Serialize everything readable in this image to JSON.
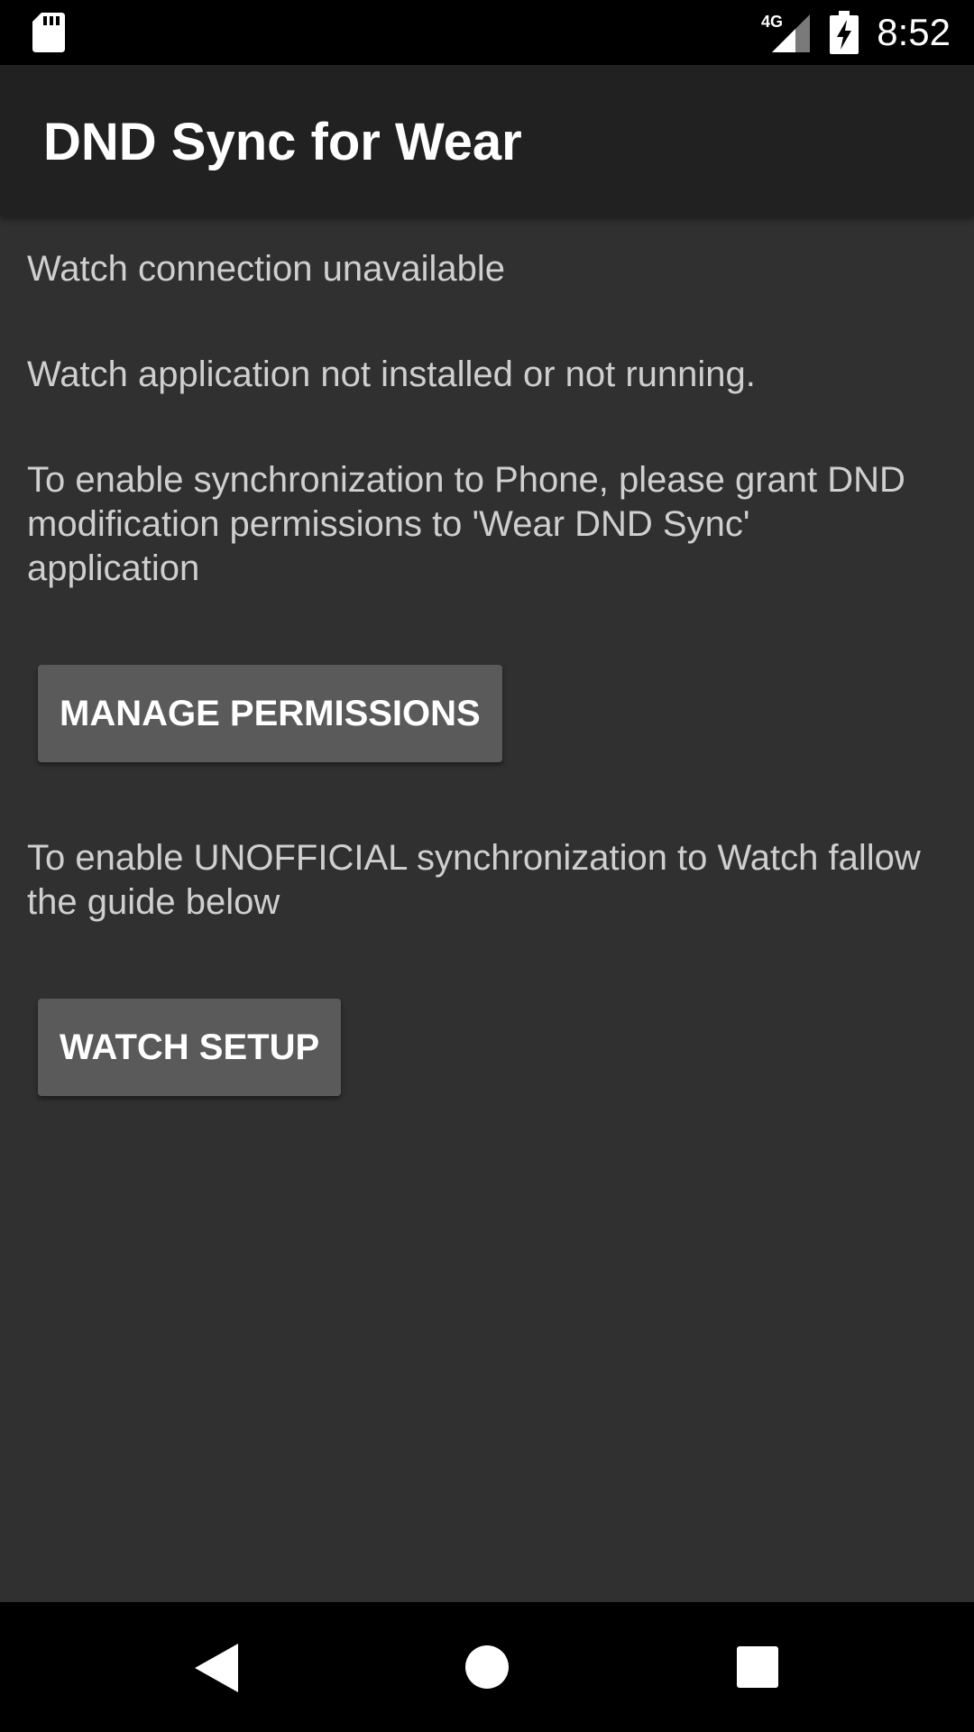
{
  "status_bar": {
    "time": "8:52",
    "network_label": "4G",
    "icons": [
      "sd-card-icon",
      "cell-signal-icon",
      "battery-charging-icon"
    ]
  },
  "toolbar": {
    "title": "DND Sync for Wear"
  },
  "content": {
    "connection_status": "Watch connection unavailable",
    "app_status": "Watch application not installed or not running.",
    "phone_sync_info": "To enable synchronization to Phone, please grant DND modification permissions to 'Wear DND Sync' application",
    "manage_permissions_label": "MANAGE PERMISSIONS",
    "watch_sync_info": "To enable UNOFFICIAL synchronization to Watch fallow the guide below",
    "watch_setup_label": "WATCH SETUP"
  },
  "nav_bar": {
    "icons": [
      "back-icon",
      "home-icon",
      "recents-icon"
    ]
  },
  "colors": {
    "background": "#303030",
    "toolbar": "#212121",
    "button": "#5a5a5b",
    "text": "#cfcfcf",
    "system_bar": "#000000"
  }
}
